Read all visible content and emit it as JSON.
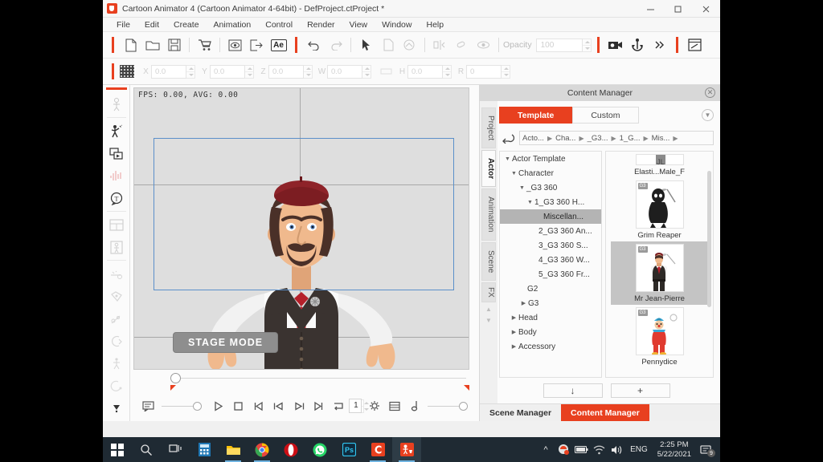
{
  "window": {
    "title": "Cartoon Animator 4  (Cartoon Animator 4-64bit) - DefProject.ctProject *",
    "minimize": "–",
    "maximize": "❐",
    "close": "✕"
  },
  "menubar": {
    "items": [
      "File",
      "Edit",
      "Create",
      "Animation",
      "Control",
      "Render",
      "View",
      "Window",
      "Help"
    ]
  },
  "toolbar": {
    "ae_label": "Ae",
    "opacity_label": "Opacity",
    "opacity_value": "100"
  },
  "transform": {
    "fields": [
      {
        "label": "X",
        "value": "0.0"
      },
      {
        "label": "Y",
        "value": "0.0"
      },
      {
        "label": "Z",
        "value": "0.0"
      },
      {
        "label": "W",
        "value": "0.0"
      },
      {
        "label": "H",
        "value": "0.0"
      },
      {
        "label": "R",
        "value": "0"
      }
    ]
  },
  "stage": {
    "fps_text": "FPS: 0.00, AVG: 0.00",
    "mode_badge": "STAGE MODE"
  },
  "timeline": {
    "frame_value": "1"
  },
  "panel": {
    "title": "Content Manager",
    "close": "✕",
    "vtabs": [
      {
        "label": "Project",
        "active": false
      },
      {
        "label": "Actor",
        "active": true
      },
      {
        "label": "Animation",
        "active": false
      },
      {
        "label": "Scene",
        "active": false
      },
      {
        "label": "FX",
        "active": false
      }
    ],
    "tabs": [
      {
        "label": "Template",
        "active": true
      },
      {
        "label": "Custom",
        "active": false
      }
    ],
    "breadcrumb": [
      "Acto...",
      "Cha...",
      "_G3...",
      "1_G...",
      "Mis..."
    ],
    "tree": [
      {
        "label": "Actor Template",
        "depth": 0,
        "arrow": "▼",
        "selected": false
      },
      {
        "label": "Character",
        "depth": 1,
        "arrow": "▼",
        "selected": false
      },
      {
        "label": "_G3 360",
        "depth": 2,
        "arrow": "▼",
        "selected": false
      },
      {
        "label": "1_G3 360 H...",
        "depth": 3,
        "arrow": "▼",
        "selected": false
      },
      {
        "label": "Miscellan...",
        "depth": 5,
        "arrow": "",
        "selected": true
      },
      {
        "label": "2_G3 360 An...",
        "depth": 4,
        "arrow": "",
        "selected": false
      },
      {
        "label": "3_G3 360 S...",
        "depth": 4,
        "arrow": "",
        "selected": false
      },
      {
        "label": "4_G3 360 W...",
        "depth": 4,
        "arrow": "",
        "selected": false
      },
      {
        "label": "5_G3 360 Fr...",
        "depth": 4,
        "arrow": "",
        "selected": false
      },
      {
        "label": "G2",
        "depth": 3,
        "arrow": "",
        "selected": false
      },
      {
        "label": "G3",
        "depth": 3,
        "arrow": "▶",
        "selected": false
      },
      {
        "label": "Head",
        "depth": 1,
        "arrow": "▶",
        "selected": false
      },
      {
        "label": "Body",
        "depth": 1,
        "arrow": "▶",
        "selected": false
      },
      {
        "label": "Accessory",
        "depth": 1,
        "arrow": "▶",
        "selected": false
      }
    ],
    "thumbnails": [
      {
        "label": "Elasti...Male_F",
        "badge": "G3",
        "selected": false,
        "kind": "partial"
      },
      {
        "label": "Grim Reaper",
        "badge": "G3",
        "selected": false,
        "kind": "reaper"
      },
      {
        "label": "Mr Jean-Pierre",
        "badge": "G3",
        "selected": true,
        "kind": "jeanpierre"
      },
      {
        "label": "Pennydice",
        "badge": "G3",
        "selected": false,
        "kind": "clown"
      }
    ],
    "buttons": [
      {
        "name": "download",
        "glyph": "↓"
      },
      {
        "name": "add",
        "glyph": "+"
      }
    ],
    "bottom_tabs": [
      {
        "label": "Scene Manager",
        "active": false
      },
      {
        "label": "Content Manager",
        "active": true
      }
    ]
  },
  "taskbar": {
    "language": "ENG",
    "time": "2:25 PM",
    "date": "5/22/2021",
    "notification_count": "9"
  },
  "colors": {
    "accent": "#e8401f",
    "selection": "#5b8fc9",
    "taskbar": "#1f2a33",
    "panel_header": "#d8d8d8"
  }
}
